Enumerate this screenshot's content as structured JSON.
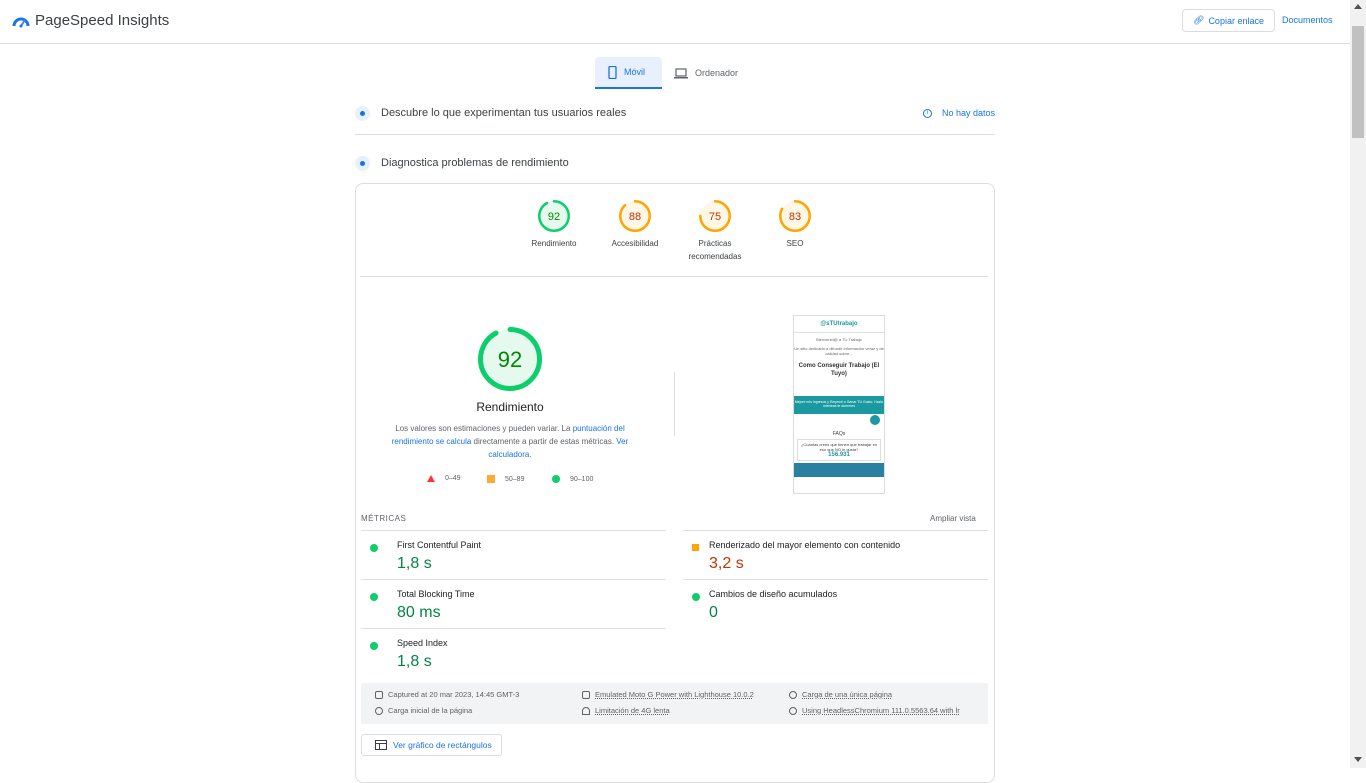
{
  "header": {
    "app_title": "PageSpeed Insights",
    "copy_link_label": "Copiar enlace",
    "docs_label": "Documentos"
  },
  "tabs": [
    {
      "label": "Móvil",
      "active": true,
      "icon": "smartphone-icon"
    },
    {
      "label": "Ordenador",
      "active": false,
      "icon": "laptop-icon"
    }
  ],
  "field_data": {
    "title": "Descubre lo que experimentan tus usuarios reales",
    "status": "No hay datos"
  },
  "lab_data": {
    "title": "Diagnostica problemas de rendimiento"
  },
  "scores": [
    {
      "value": "92",
      "label": "Rendimiento",
      "fraction": 0.92,
      "color": "#0cce6b",
      "text_color": "#008800"
    },
    {
      "value": "88",
      "label": "Accesibilidad",
      "fraction": 0.88,
      "color": "#ffa400",
      "text_color": "#c33300"
    },
    {
      "value": "75",
      "label": "Prácticas recomendadas",
      "fraction": 0.75,
      "color": "#ffa400",
      "text_color": "#c33300"
    },
    {
      "value": "83",
      "label": "SEO",
      "fraction": 0.83,
      "color": "#ffa400",
      "text_color": "#c33300"
    }
  ],
  "performance": {
    "score": "92",
    "fraction": 0.92,
    "title": "Rendimiento",
    "desc_1": "Los valores son estimaciones y pueden variar. La ",
    "desc_link_1": "puntuación del rendimiento se calcula",
    "desc_2": " directamente a partir de estas métricas. ",
    "desc_link_2": "Ver calculadora",
    "desc_3": ".",
    "legend": [
      {
        "range": "0–49",
        "shape": "triangle",
        "color": "#ff3333"
      },
      {
        "range": "50–89",
        "shape": "square",
        "color": "#ffaa33"
      },
      {
        "range": "90–100",
        "shape": "circle",
        "color": "#0cce6b"
      }
    ]
  },
  "screenshot": {
    "site_name": "@sTUtrabajo",
    "welcome": "Bienvenid@ a TU Trabajo",
    "intro": "Un sitio dedicado a difundir información veraz y de calidad sobre...",
    "headline": "Como Conseguir Trabajo (El Tuyo)",
    "banner": "Mejoré mis Ingresos y Empecé a Ganar TU Gusto. Hazlo mientras te duermes",
    "faq": "FAQs",
    "question": "¿Cuántas crees que tienen que trabajar en eso que NO le gusta?",
    "number": "156.931"
  },
  "metrics": {
    "heading": "MÉTRICAS",
    "expand_label": "Ampliar vista",
    "items": [
      {
        "name": "First Contentful Paint",
        "value": "1,8 s",
        "status": "good"
      },
      {
        "name": "Renderizado del mayor elemento con contenido",
        "value": "3,2 s",
        "status": "average"
      },
      {
        "name": "Total Blocking Time",
        "value": "80 ms",
        "status": "good"
      },
      {
        "name": "Cambios de diseño acumulados",
        "value": "0",
        "status": "good"
      },
      {
        "name": "Speed Index",
        "value": "1,8 s",
        "status": "good"
      }
    ]
  },
  "environment": {
    "captured": "Captured at 20 mar 2023, 14:45 GMT-3",
    "device": "Emulated Moto G Power with Lighthouse 10.0.2",
    "session": "Carga de una única página",
    "load": "Carga inicial de la página",
    "network": "Limitación de 4G lenta",
    "browser": "Using HeadlessChromium 111.0.5563.64 with lr"
  },
  "treemap_label": "Ver gráfico de rectángulos",
  "colors": {
    "accent": "#1a73e8",
    "good": "#0cce6b",
    "average": "#ffa400",
    "poor": "#ff3333"
  }
}
